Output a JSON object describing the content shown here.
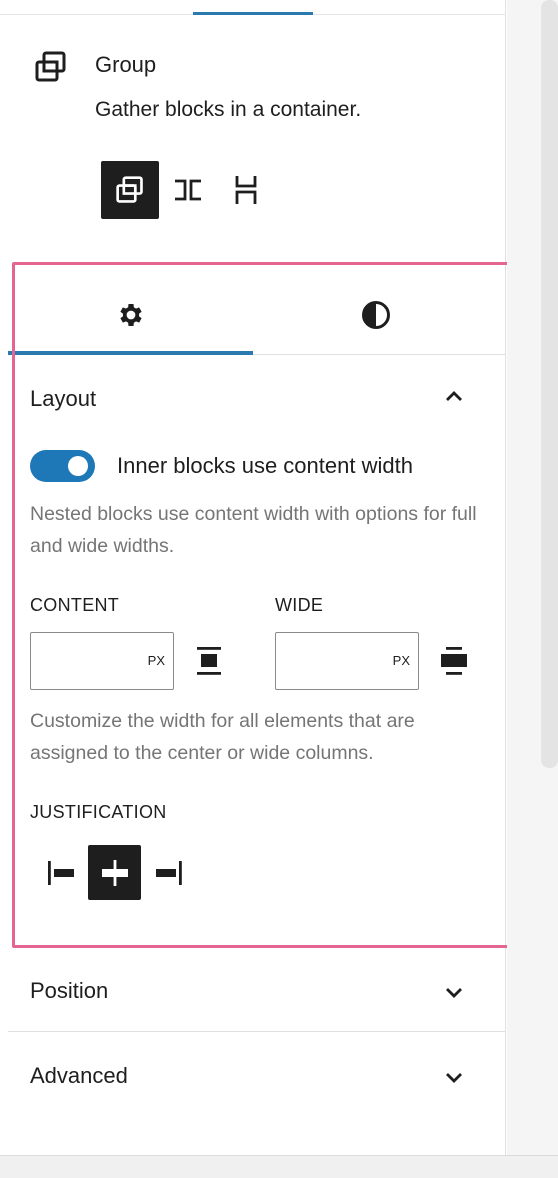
{
  "block": {
    "icon": "group-icon",
    "title": "Group",
    "description": "Gather blocks in a container."
  },
  "variations": [
    {
      "name": "group",
      "icon": "group-icon",
      "active": true
    },
    {
      "name": "row",
      "icon": "row-icon",
      "active": false
    },
    {
      "name": "stack",
      "icon": "stack-icon",
      "active": false
    }
  ],
  "tabs": [
    {
      "name": "settings",
      "icon": "gear-icon",
      "active": true
    },
    {
      "name": "styles",
      "icon": "half-circle-icon",
      "active": false
    }
  ],
  "layout": {
    "title": "Layout",
    "expanded": true,
    "toggle_label": "Inner blocks use content width",
    "toggle_on": true,
    "toggle_help": "Nested blocks use content width with options for full and wide widths.",
    "content_label": "CONTENT",
    "content_value": "",
    "content_unit": "PX",
    "wide_label": "WIDE",
    "wide_value": "",
    "wide_unit": "PX",
    "width_help": "Customize the width for all elements that are assigned to the center or wide columns.",
    "justification_label": "JUSTIFICATION",
    "justification_options": [
      "left",
      "center",
      "right"
    ],
    "justification_selected": "center"
  },
  "sections": [
    {
      "title": "Position",
      "expanded": false
    },
    {
      "title": "Advanced",
      "expanded": false
    }
  ],
  "colors": {
    "accent": "#2a7ab0",
    "toggle": "#1e78b8",
    "highlight": "#e26592",
    "dark": "#1e1e1e"
  }
}
